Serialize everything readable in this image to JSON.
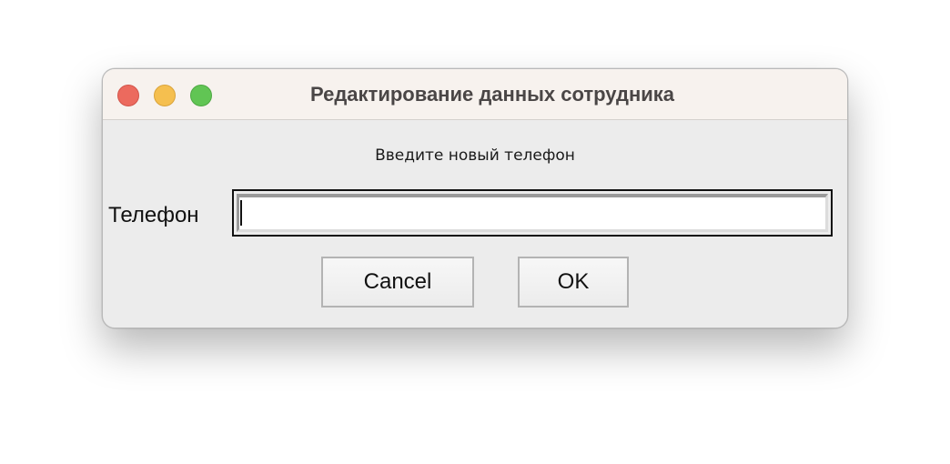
{
  "window": {
    "title": "Редактирование данных сотрудника",
    "controls": [
      "close",
      "minimize",
      "zoom"
    ],
    "colors": {
      "close": "#ec6a5e",
      "minimize": "#f5bf4f",
      "zoom": "#61c554",
      "titlebar": "#f7f2ee",
      "body": "#ececec"
    }
  },
  "dialog": {
    "prompt": "Введите новый телефон",
    "field_label": "Телефон",
    "field_value": "",
    "cancel_label": "Cancel",
    "ok_label": "OK"
  }
}
